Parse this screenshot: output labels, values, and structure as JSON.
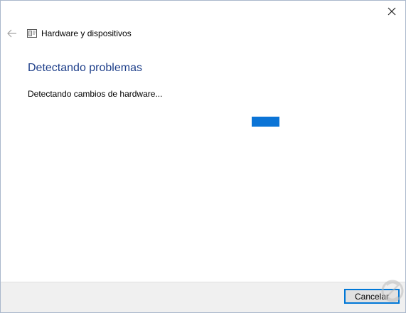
{
  "window": {
    "close_icon": "close-icon",
    "back_icon": "back-arrow-icon",
    "app_icon": "hardware-devices-icon",
    "title": "Hardware y dispositivos"
  },
  "main": {
    "heading": "Detectando problemas",
    "status": "Detectando cambios de hardware...",
    "progress": {
      "type": "indeterminate",
      "color": "#0b74d6"
    }
  },
  "footer": {
    "cancel_label": "Cancelar"
  },
  "colors": {
    "heading": "#1e3f8a",
    "accent": "#0078d7",
    "footer_bg": "#f0f0f0"
  }
}
